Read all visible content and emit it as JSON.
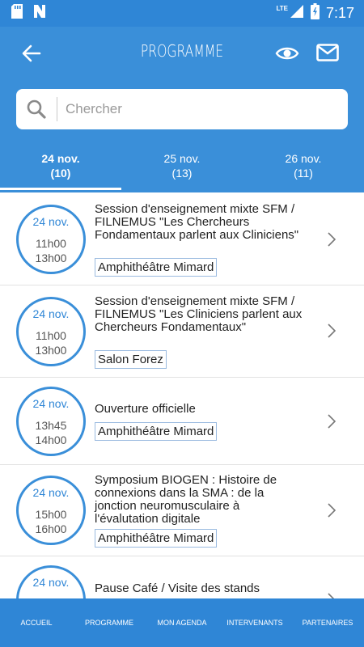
{
  "status_bar": {
    "time": "7:17",
    "network": "LTE"
  },
  "header": {
    "title": "PROGRAMME"
  },
  "search": {
    "placeholder": "Chercher",
    "value": ""
  },
  "tabs": [
    {
      "date": "24 nov.",
      "count": "(10)",
      "active": true
    },
    {
      "date": "25 nov.",
      "count": "(13)",
      "active": false
    },
    {
      "date": "26 nov.",
      "count": "(11)",
      "active": false
    }
  ],
  "sessions": [
    {
      "date": "24 nov.",
      "start": "11h00",
      "end": "13h00",
      "title": "Session d'enseignement mixte SFM / FILNEMUS \"Les Chercheurs Fondamentaux parlent aux Cliniciens\"",
      "room": "Amphithéâtre Mimard"
    },
    {
      "date": "24 nov.",
      "start": "11h00",
      "end": "13h00",
      "title": "Session d'enseignement mixte SFM / FILNEMUS \"Les Cliniciens parlent aux Chercheurs Fondamentaux\"",
      "room": "Salon Forez"
    },
    {
      "date": "24 nov.",
      "start": "13h45",
      "end": "14h00",
      "title": "Ouverture officielle",
      "room": "Amphithéâtre Mimard"
    },
    {
      "date": "24 nov.",
      "start": "15h00",
      "end": "16h00",
      "title": "Symposium BIOGEN : Histoire de connexions dans la SMA : de la jonction neuromusculaire à l'évalutation digitale",
      "room": "Amphithéâtre Mimard"
    },
    {
      "date": "24 nov.",
      "start": "",
      "end": "",
      "title": "Pause Café / Visite des stands",
      "room": ""
    }
  ],
  "bottom_nav": [
    {
      "label": "ACCUEIL"
    },
    {
      "label": "PROGRAMME"
    },
    {
      "label": "MON AGENDA"
    },
    {
      "label": "INTERVENANTS"
    },
    {
      "label": "PARTENAIRES"
    }
  ]
}
